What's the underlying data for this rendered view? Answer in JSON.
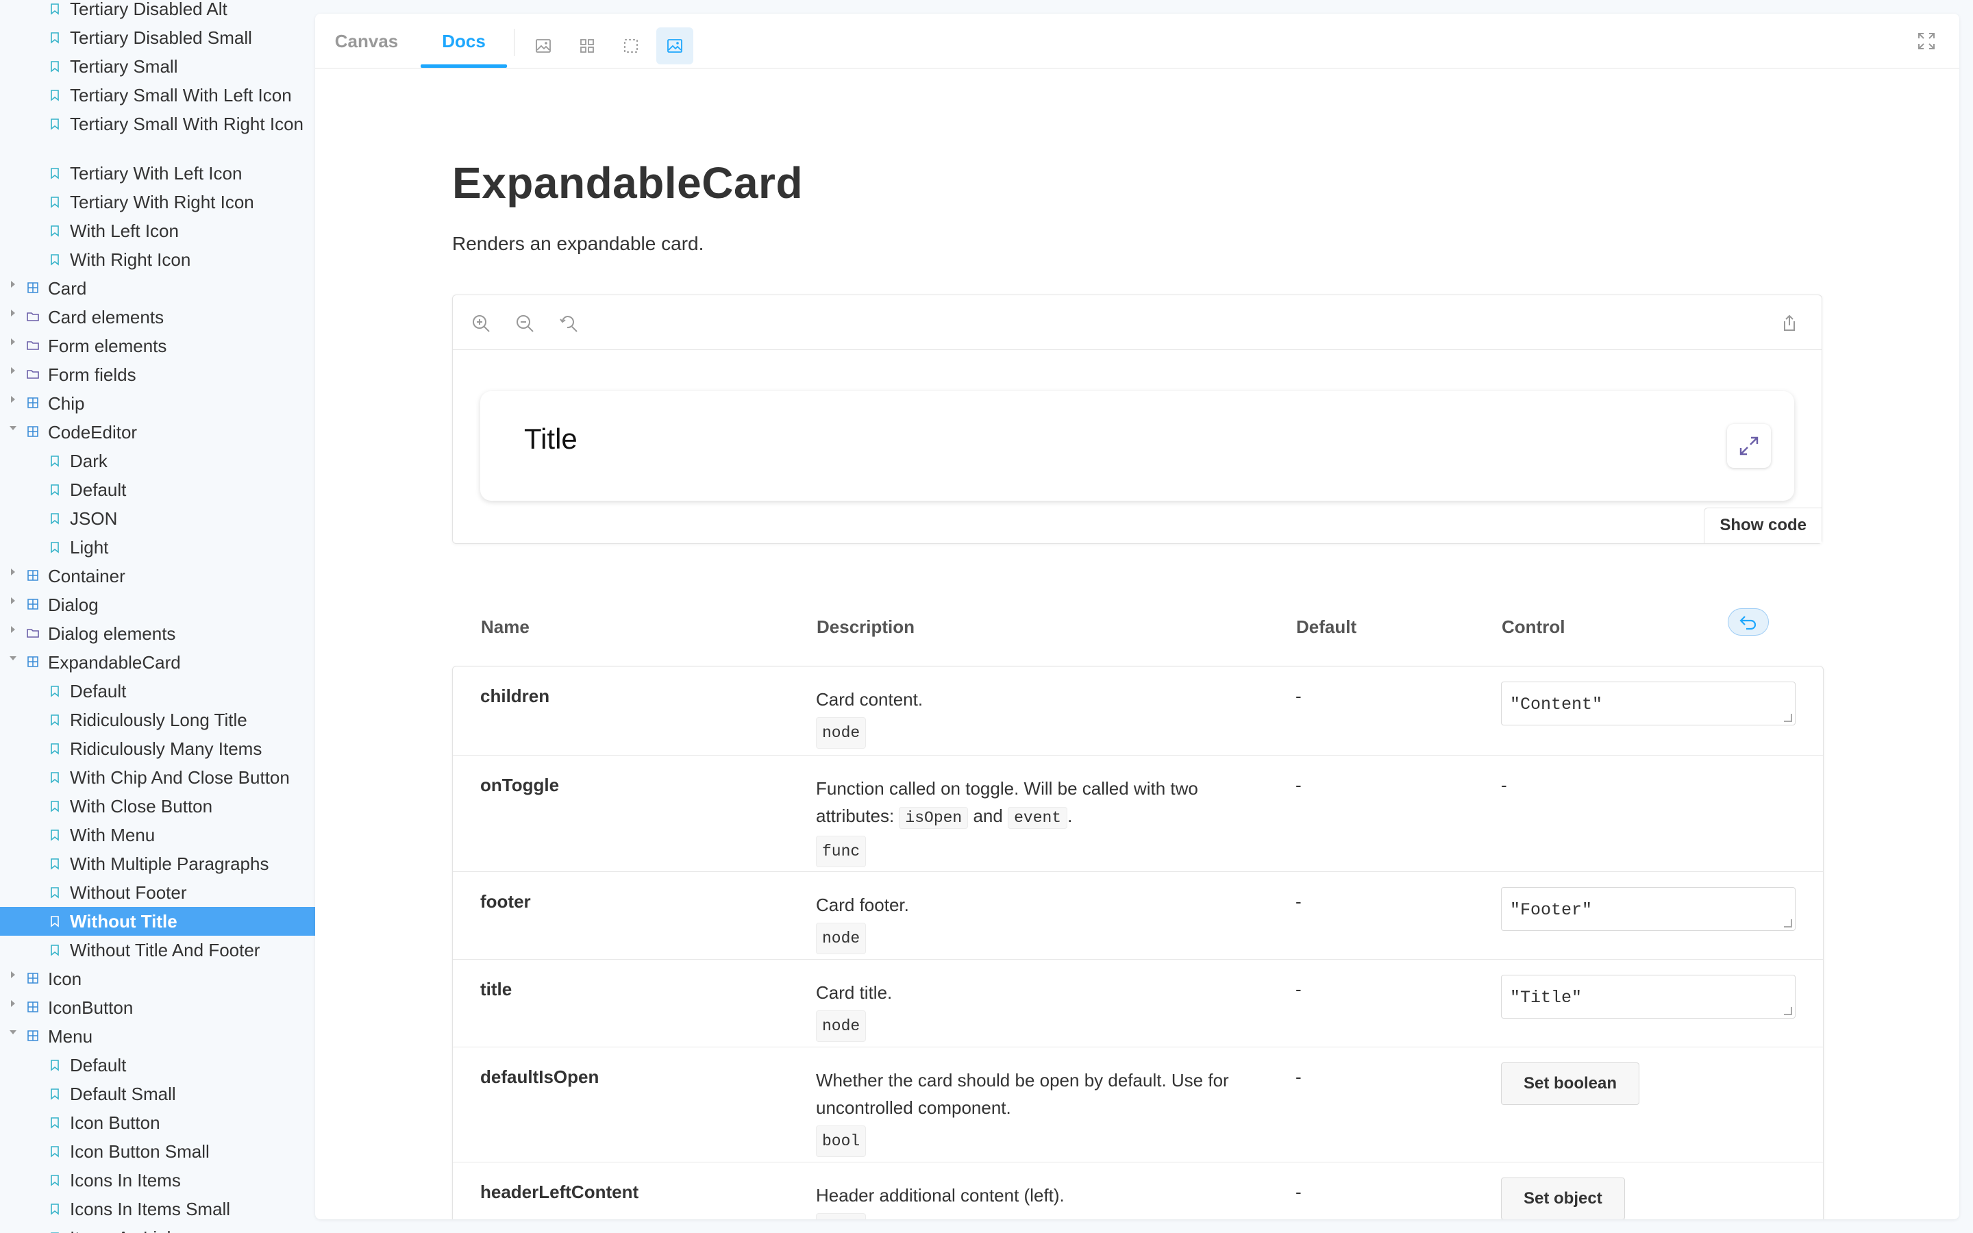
{
  "sidebar": {
    "items": [
      {
        "label": "Tertiary Disabled Alt",
        "level": 2,
        "icon": "bookmark-icon"
      },
      {
        "label": "Tertiary Disabled Small",
        "level": 2,
        "icon": "bookmark-icon"
      },
      {
        "label": "Tertiary Small",
        "level": 2,
        "icon": "bookmark-icon"
      },
      {
        "label": "Tertiary Small With Left Icon",
        "level": 2,
        "icon": "bookmark-icon"
      },
      {
        "label": "Tertiary Small With Right Icon",
        "level": 2,
        "icon": "bookmark-icon"
      },
      {
        "label": "Tertiary With Left Icon",
        "level": 2,
        "icon": "bookmark-icon"
      },
      {
        "label": "Tertiary With Right Icon",
        "level": 2,
        "icon": "bookmark-icon"
      },
      {
        "label": "With Left Icon",
        "level": 2,
        "icon": "bookmark-icon"
      },
      {
        "label": "With Right Icon",
        "level": 2,
        "icon": "bookmark-icon"
      },
      {
        "label": "Card",
        "level": 1,
        "icon": "component-icon",
        "expanded": false
      },
      {
        "label": "Card elements",
        "level": 1,
        "icon": "folder-icon",
        "expanded": false
      },
      {
        "label": "Form elements",
        "level": 1,
        "icon": "folder-icon",
        "expanded": false
      },
      {
        "label": "Form fields",
        "level": 1,
        "icon": "folder-icon",
        "expanded": false
      },
      {
        "label": "Chip",
        "level": 1,
        "icon": "component-icon",
        "expanded": false
      },
      {
        "label": "CodeEditor",
        "level": 1,
        "icon": "component-icon",
        "expanded": true
      },
      {
        "label": "Dark",
        "level": 2,
        "icon": "bookmark-icon"
      },
      {
        "label": "Default",
        "level": 2,
        "icon": "bookmark-icon"
      },
      {
        "label": "JSON",
        "level": 2,
        "icon": "bookmark-icon"
      },
      {
        "label": "Light",
        "level": 2,
        "icon": "bookmark-icon"
      },
      {
        "label": "Container",
        "level": 1,
        "icon": "component-icon",
        "expanded": false
      },
      {
        "label": "Dialog",
        "level": 1,
        "icon": "component-icon",
        "expanded": false
      },
      {
        "label": "Dialog elements",
        "level": 1,
        "icon": "folder-icon",
        "expanded": false
      },
      {
        "label": "ExpandableCard",
        "level": 1,
        "icon": "component-icon",
        "expanded": true
      },
      {
        "label": "Default",
        "level": 2,
        "icon": "bookmark-icon"
      },
      {
        "label": "Ridiculously Long Title",
        "level": 2,
        "icon": "bookmark-icon"
      },
      {
        "label": "Ridiculously Many Items",
        "level": 2,
        "icon": "bookmark-icon"
      },
      {
        "label": "With Chip And Close Button",
        "level": 2,
        "icon": "bookmark-icon"
      },
      {
        "label": "With Close Button",
        "level": 2,
        "icon": "bookmark-icon"
      },
      {
        "label": "With Menu",
        "level": 2,
        "icon": "bookmark-icon"
      },
      {
        "label": "With Multiple Paragraphs",
        "level": 2,
        "icon": "bookmark-icon"
      },
      {
        "label": "Without Footer",
        "level": 2,
        "icon": "bookmark-icon"
      },
      {
        "label": "Without Title",
        "level": 2,
        "icon": "bookmark-icon",
        "selected": true
      },
      {
        "label": "Without Title And Footer",
        "level": 2,
        "icon": "bookmark-icon"
      },
      {
        "label": "Icon",
        "level": 1,
        "icon": "component-icon",
        "expanded": false
      },
      {
        "label": "IconButton",
        "level": 1,
        "icon": "component-icon",
        "expanded": false
      },
      {
        "label": "Menu",
        "level": 1,
        "icon": "component-icon",
        "expanded": true
      },
      {
        "label": "Default",
        "level": 2,
        "icon": "bookmark-icon"
      },
      {
        "label": "Default Small",
        "level": 2,
        "icon": "bookmark-icon"
      },
      {
        "label": "Icon Button",
        "level": 2,
        "icon": "bookmark-icon"
      },
      {
        "label": "Icon Button Small",
        "level": 2,
        "icon": "bookmark-icon"
      },
      {
        "label": "Icons In Items",
        "level": 2,
        "icon": "bookmark-icon"
      },
      {
        "label": "Icons In Items Small",
        "level": 2,
        "icon": "bookmark-icon"
      },
      {
        "label": "Items As Links",
        "level": 2,
        "icon": "bookmark-icon"
      }
    ]
  },
  "toolbar": {
    "tabs": [
      {
        "label": "Canvas",
        "active": false
      },
      {
        "label": "Docs",
        "active": true
      }
    ],
    "tools": [
      "image-icon",
      "grid-icon",
      "outline-icon",
      "background-image-icon"
    ],
    "fullscreen_icon": "fullscreen-icon"
  },
  "docs": {
    "title": "ExpandableCard",
    "description": "Renders an expandable card.",
    "preview": {
      "tools": [
        "zoom-in-icon",
        "zoom-out-icon",
        "reset-zoom-icon"
      ],
      "share_icon": "share-icon",
      "card_title": "Title",
      "expand_icon": "expand-icon",
      "show_code_label": "Show code"
    },
    "args_table": {
      "headers": {
        "name": "Name",
        "description": "Description",
        "default": "Default",
        "control": "Control"
      },
      "reset_icon": "undo-icon",
      "rows": [
        {
          "name": "children",
          "description": "Card content.",
          "type": "node",
          "default": "-",
          "control": {
            "kind": "text",
            "value": "\"Content\""
          }
        },
        {
          "name": "onToggle",
          "description_parts": {
            "before": "Function called on toggle. Will be called with two attributes:",
            "code1": "isOpen",
            "mid": "and",
            "code2": "event",
            "after": "."
          },
          "type": "func",
          "default": "-",
          "control": {
            "kind": "none",
            "value": "-"
          }
        },
        {
          "name": "footer",
          "description": "Card footer.",
          "type": "node",
          "default": "-",
          "control": {
            "kind": "text",
            "value": "\"Footer\""
          }
        },
        {
          "name": "title",
          "description": "Card title.",
          "type": "node",
          "default": "-",
          "control": {
            "kind": "text",
            "value": "\"Title\""
          }
        },
        {
          "name": "defaultIsOpen",
          "description": "Whether the card should be open by default. Use for uncontrolled component.",
          "type": "bool",
          "default": "-",
          "control": {
            "kind": "button",
            "value": "Set boolean"
          }
        },
        {
          "name": "headerLeftContent",
          "description": "Header additional content (left).",
          "type": "node",
          "default": "-",
          "control": {
            "kind": "button",
            "value": "Set object"
          }
        }
      ]
    }
  },
  "colors": {
    "accent": "#1ea7fd",
    "selected_bg": "#4ba6f5",
    "sidebar_bg": "#f6f9fc"
  }
}
